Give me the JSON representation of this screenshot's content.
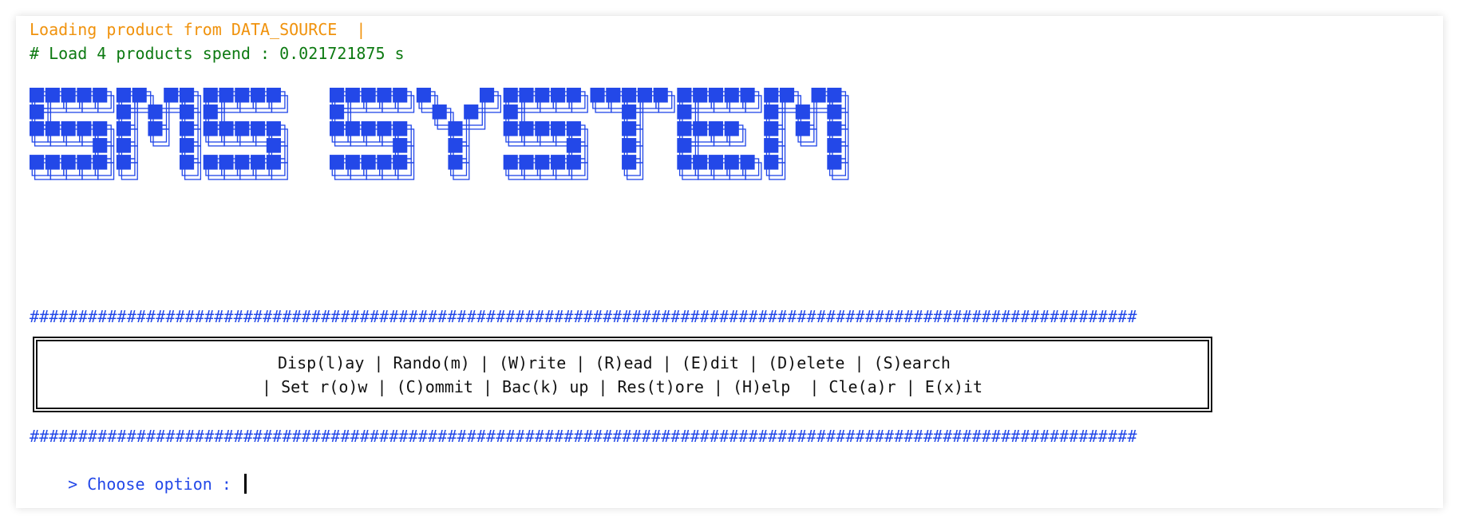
{
  "colors": {
    "orange": "#f0920c",
    "green": "#0d7a12",
    "blue": "#2348e8",
    "text": "#111111"
  },
  "status": {
    "loading_line": "Loading product from DATA_SOURCE  |",
    "timing_line": "# Load 4 products spend : 0.021721875 s"
  },
  "banner": {
    "text": "SMS SYSTEM",
    "style": "ascii-art-block-letters"
  },
  "divider": "##################################################################################################################",
  "menu": {
    "line1": "Disp(l)ay | Rando(m) | (W)rite | (R)ead | (E)dit | (D)elete | (S)earch",
    "line2": "| Set r(o)w | (C)ommit | Bac(k) up | Res(t)ore | (H)elp  | Cle(a)r | E(x)it"
  },
  "prompt": {
    "label": "> Choose option : ",
    "value": ""
  }
}
